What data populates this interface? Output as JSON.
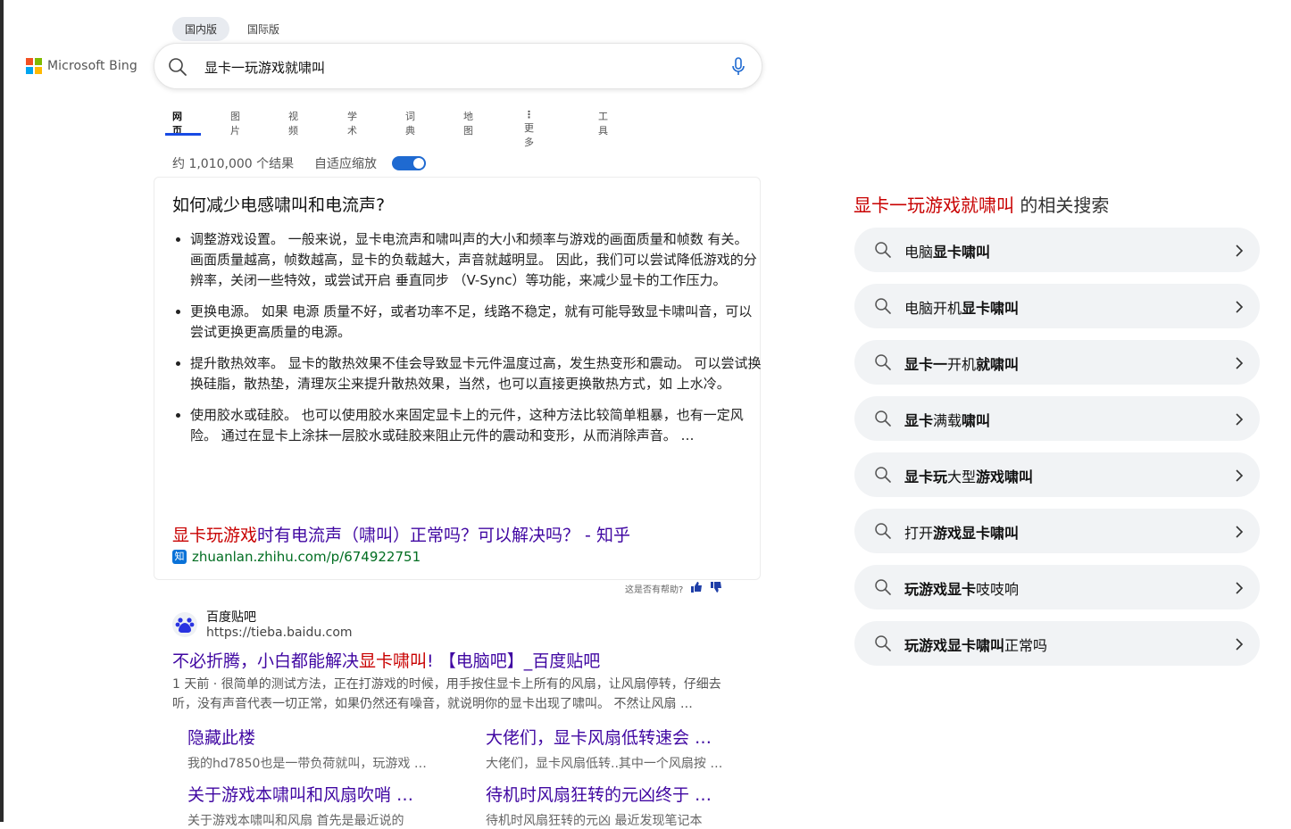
{
  "header": {
    "logo_text": "Microsoft Bing",
    "region_tabs": [
      "国内版",
      "国际版"
    ],
    "search": {
      "value": "显卡一玩游戏就啸叫"
    }
  },
  "nav": {
    "items": [
      "网页",
      "图片",
      "视频",
      "学术",
      "词典",
      "地图",
      "更多",
      "工具"
    ]
  },
  "results_meta": {
    "count_text": "约 1,010,000 个结果",
    "zoom_label": "自适应缩放"
  },
  "answer": {
    "title": "如何减少电感啸叫和电流声?",
    "bullets": [
      "调整游戏设置。 一般来说，显卡电流声和啸叫声的大小和频率与游戏的画面质量和帧数 有关。 画面质量越高，帧数越高，显卡的负载越大，声音就越明显。 因此，我们可以尝试降低游戏的分辨率，关闭一些特效，或尝试开启 垂直同步 （V-Sync）等功能，来减少显卡的工作压力。",
      "更换电源。 如果 电源 质量不好，或者功率不足，线路不稳定，就有可能导致显卡啸叫音，可以尝试更换更高质量的电源。",
      "提升散热效率。 显卡的散热效果不佳会导致显卡元件温度过高，发生热变形和震动。 可以尝试换换硅脂，散热垫，清理灰尘来提升散热效果，当然，也可以直接更换散热方式，如 上水冷。",
      "使用胶水或硅胶。 也可以使用胶水来固定显卡上的元件，这种方法比较简单粗暴，也有一定风险。 通过在显卡上涂抹一层胶水或硅胶来阻止元件的震动和变形，从而消除声音。 …"
    ],
    "link_hl": "显卡玩游戏",
    "link_rest": "时有电流声（啸叫）正常吗？可以解决吗？ - 知乎",
    "source_badge": "知",
    "source_url": "zhuanlan.zhihu.com/p/674922751",
    "helpful_text": "这是否有帮助?"
  },
  "result": {
    "site_name": "百度贴吧",
    "site_url": "https://tieba.baidu.com",
    "title_pre": "不必折腾，小白都能解决",
    "title_hl": "显卡啸叫",
    "title_post": "! 【电脑吧】_百度贴吧",
    "date": "1 天前",
    "snippet": "很简单的测试方法，正在打游戏的时候，用手按住显卡上所有的风扇，让风扇停转，仔细去听，没有声音代表一切正常，如果仍然还有噪音，就说明你的显卡出现了啸叫。 不然让风扇 …",
    "deeplinks": [
      {
        "title": "隐藏此楼",
        "desc": "我的hd7850也是一带负荷就叫，玩游戏 …"
      },
      {
        "title": "大佬们，显卡风扇低转速会 …",
        "desc": "大佬们，显卡风扇低转..其中一个风扇按 …"
      },
      {
        "title": "关于游戏本啸叫和风扇吹哨 …",
        "desc": "关于游戏本啸叫和风扇 首先是最近说的"
      },
      {
        "title": "待机时风扇狂转的元凶终于 …",
        "desc": "待机时风扇狂转的元凶 最近发现笔记本"
      }
    ]
  },
  "related": {
    "title_hl": "显卡一玩游戏就啸叫",
    "title_rest": " 的相关搜索",
    "items": [
      {
        "plain": "电脑",
        "bold": "显卡啸叫",
        "tail": ""
      },
      {
        "plain": "电脑开机",
        "bold": "显卡啸叫",
        "tail": ""
      },
      {
        "plain": "",
        "bold": "显卡一",
        "tail": "开机",
        "bold2": "就啸叫"
      },
      {
        "plain": "",
        "bold": "显卡",
        "tail": "满载",
        "bold2": "啸叫"
      },
      {
        "plain": "",
        "bold": "显卡玩",
        "tail": "大型",
        "bold2": "游戏啸叫"
      },
      {
        "plain": "打开",
        "bold": "游戏显卡啸叫",
        "tail": ""
      },
      {
        "plain": "",
        "bold": "玩游戏显卡",
        "tail": "吱吱响"
      },
      {
        "plain": "",
        "bold": "玩游戏显卡啸叫",
        "tail": "正常吗"
      }
    ]
  },
  "colors": {
    "accent": "#174ae4",
    "link": "#4007a2",
    "highlight": "#c80000",
    "url": "#006d21"
  }
}
